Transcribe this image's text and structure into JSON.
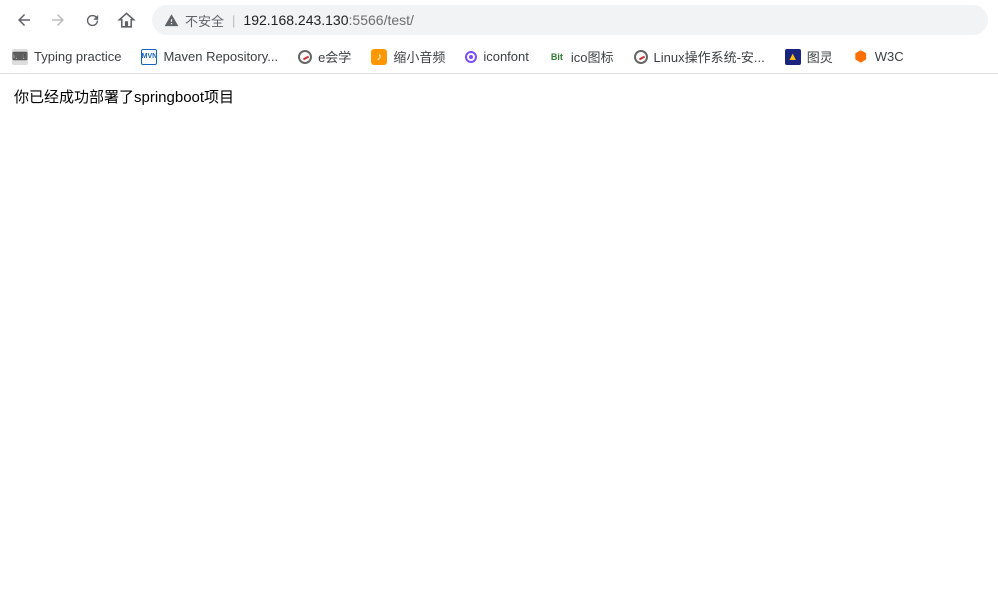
{
  "toolbar": {
    "security_label": "不安全",
    "url_host": "192.168.243.130",
    "url_port": ":5566",
    "url_path": "/test/"
  },
  "bookmarks": [
    {
      "label": "Typing practice",
      "icon": "typing"
    },
    {
      "label": "Maven Repository...",
      "icon": "mvn"
    },
    {
      "label": "e会学",
      "icon": "circle-red"
    },
    {
      "label": "缩小音频",
      "icon": "orange-box"
    },
    {
      "label": "iconfont",
      "icon": "purple-circle"
    },
    {
      "label": "ico图标",
      "icon": "bit"
    },
    {
      "label": "Linux操作系统-安...",
      "icon": "circle-red"
    },
    {
      "label": "图灵",
      "icon": "blue-box"
    },
    {
      "label": "W3C",
      "icon": "orange-hex"
    }
  ],
  "page": {
    "message": "你已经成功部署了springboot项目"
  }
}
